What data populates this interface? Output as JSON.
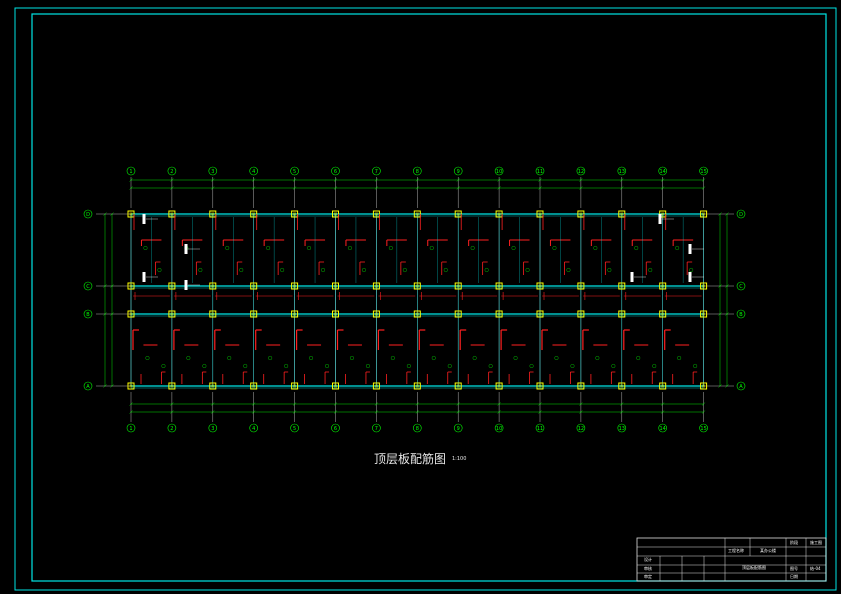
{
  "drawing": {
    "title": "顶层板配筋图",
    "scale": "1:100",
    "grid_columns": [
      "1",
      "2",
      "3",
      "4",
      "5",
      "6",
      "7",
      "8",
      "9",
      "10",
      "11",
      "12",
      "13",
      "14",
      "15"
    ],
    "grid_rows": [
      "D",
      "C",
      "B",
      "A"
    ],
    "colors": {
      "frame": "#00e5e5",
      "grid": "#e0e0e0",
      "dimension": "#00e000",
      "beam": "#00e5e5",
      "column": "#ffff00",
      "rebar_top": "#ff2020",
      "rebar_bottom": "#ff2020",
      "bubble": "#00ff00",
      "annotation": "#ffffff"
    }
  },
  "title_block": {
    "project_label": "工程名称",
    "project_value": "某办公楼",
    "drawing_name": "顶层板配筋图",
    "sheet_label": "图号",
    "sheet_value": "结-04",
    "stage_label": "阶段",
    "stage_value": "施工图",
    "date_label": "日期",
    "designer_label": "设计",
    "checker_label": "审核",
    "approver_label": "审定"
  }
}
